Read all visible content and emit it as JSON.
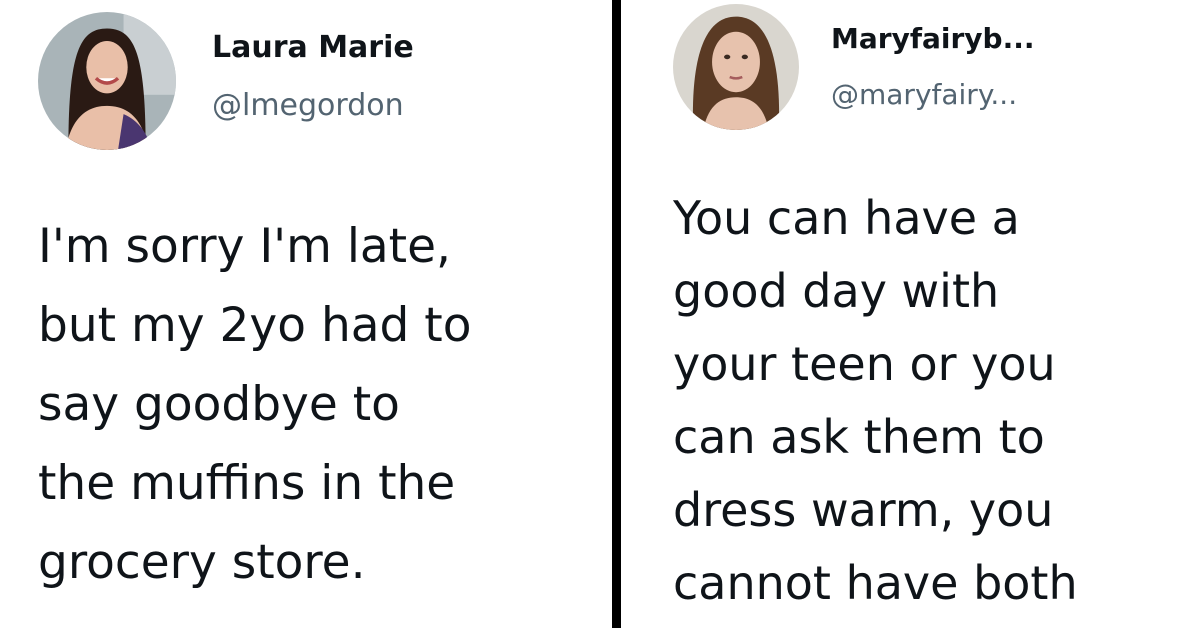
{
  "tweets": [
    {
      "display_name": "Laura Marie",
      "handle": "@lmegordon",
      "avatar_icon": "profile-photo",
      "lines": [
        "I'm sorry I'm late,",
        "but my 2yo had to",
        "say goodbye to",
        "the muffins in the",
        "grocery store."
      ]
    },
    {
      "display_name": "Maryfairyb...",
      "handle": "@maryfairy...",
      "avatar_icon": "profile-photo",
      "lines": [
        "You can have a",
        "good day with",
        "your teen or you",
        "can ask them to",
        "dress warm, you",
        "cannot have both"
      ]
    }
  ],
  "colors": {
    "divider": "#000000",
    "name": "#0f1419",
    "handle": "#536471",
    "background": "#ffffff"
  }
}
